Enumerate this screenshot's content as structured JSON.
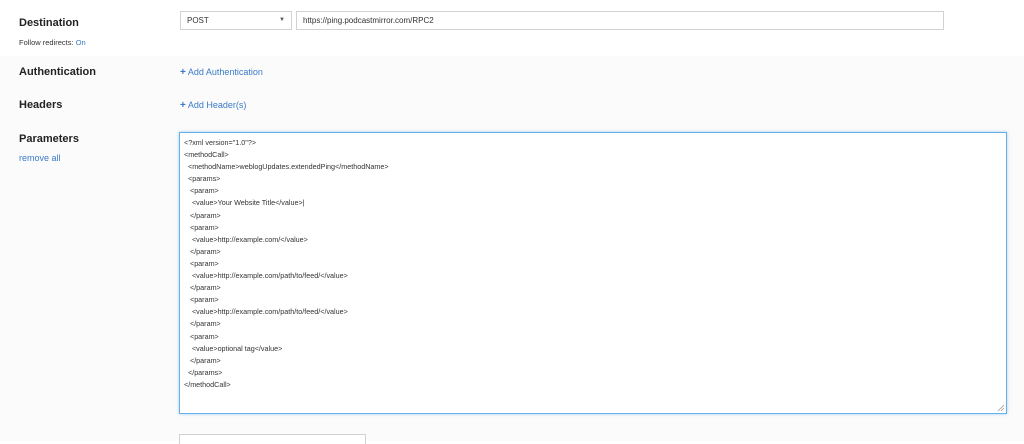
{
  "destination": {
    "label": "Destination",
    "follow_redirects_label": "Follow redirects:",
    "follow_redirects_value": "On",
    "method": "POST",
    "url": "https://ping.podcastmirror.com/RPC2"
  },
  "authentication": {
    "label": "Authentication",
    "add_label": "Add Authentication"
  },
  "headers": {
    "label": "Headers",
    "add_label": "Add Header(s)"
  },
  "parameters": {
    "label": "Parameters",
    "remove_all_label": "remove all",
    "body": "<?xml version=\"1.0\"?>\n<methodCall>\n  <methodName>weblogUpdates.extendedPing</methodName>\n  <params>\n   <param>\n    <value>Your Website Title</value>|\n   </param>\n   <param>\n    <value>http://example.com/</value>\n   </param>\n   <param>\n    <value>http://example.com/path/to/feed/</value>\n   </param>\n   <param>\n    <value>http://example.com/path/to/feed/</value>\n   </param>\n   <param>\n    <value>optional tag</value>\n   </param>\n  </params>\n</methodCall>"
  },
  "icons": {
    "add": "plus-icon",
    "select": "caret-down-icon",
    "resize": "resize-grip-icon"
  },
  "colors": {
    "link": "#3a7bc8",
    "focus_border": "#66afe9"
  }
}
